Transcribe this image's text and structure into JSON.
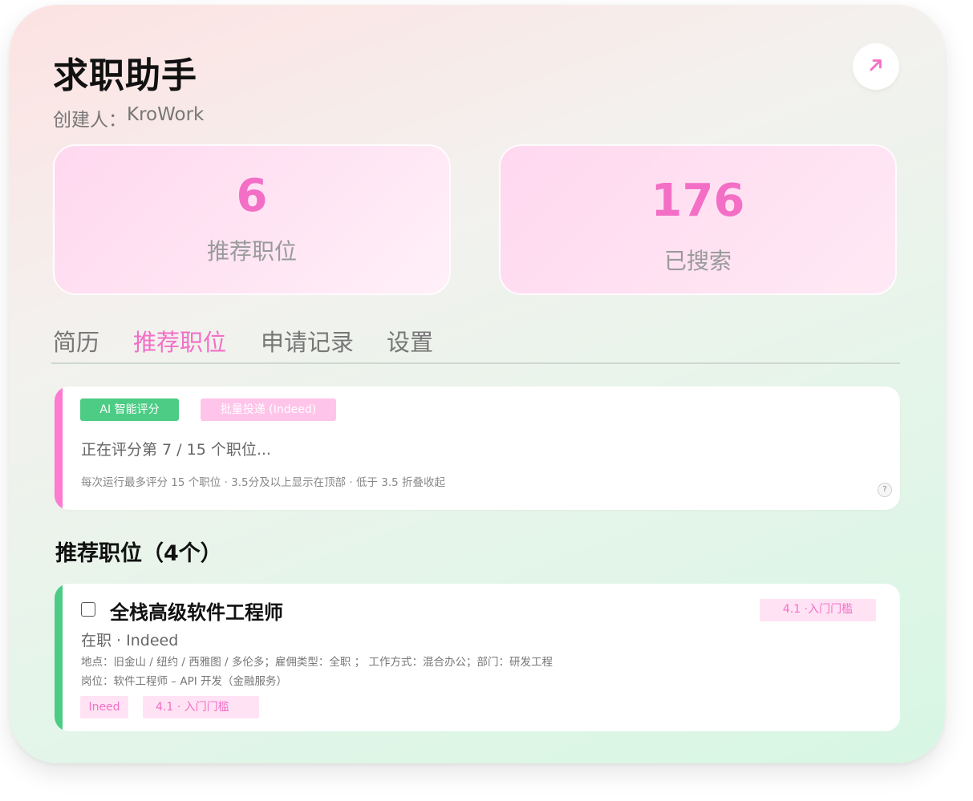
{
  "header": {
    "title": "求职助手",
    "creator_label": "创建人：",
    "creator_name": "KroWork"
  },
  "stats": [
    {
      "value": "6",
      "label": "推荐职位"
    },
    {
      "value": "176",
      "label": "已搜索"
    }
  ],
  "tabs": [
    {
      "label": "简历",
      "active": false
    },
    {
      "label": "推荐职位",
      "active": true
    },
    {
      "label": "申请记录",
      "active": false
    },
    {
      "label": "设置",
      "active": false
    }
  ],
  "scoring_panel": {
    "ai_button": "AI 智能评分",
    "batch_button": "批量投递 (Indeed)",
    "progress": "正在评分第 7 / 15 个职位...",
    "hint": "每次运行最多评分 15 个职位 · 3.5分及以上显示在顶部 · 低于 3.5 折叠收起",
    "help": "?"
  },
  "section": {
    "title": "推荐职位（4个）"
  },
  "jobs": [
    {
      "title": "全栈高级软件工程师",
      "score_badge": "4.1  ·入门门槛",
      "status": "在职 · Indeed",
      "meta_line1": "地点：旧金山 / 纽约 / 西雅图 / 多伦多；雇佣类型：全职 ； 工作方式：混合办公；部门：研发工程",
      "meta_line2": "岗位：软件工程师 – API 开发（金融服务）",
      "source_tag": "Ineed",
      "score_tag": "4.1  · 入门门槛"
    }
  ],
  "colors": {
    "accent_pink": "#f36fc6",
    "accent_green": "#4ccc84",
    "panel_bar_pink": "#ff7ad0"
  },
  "icons": {
    "open": "arrow-up-right-icon",
    "help": "question-icon"
  }
}
